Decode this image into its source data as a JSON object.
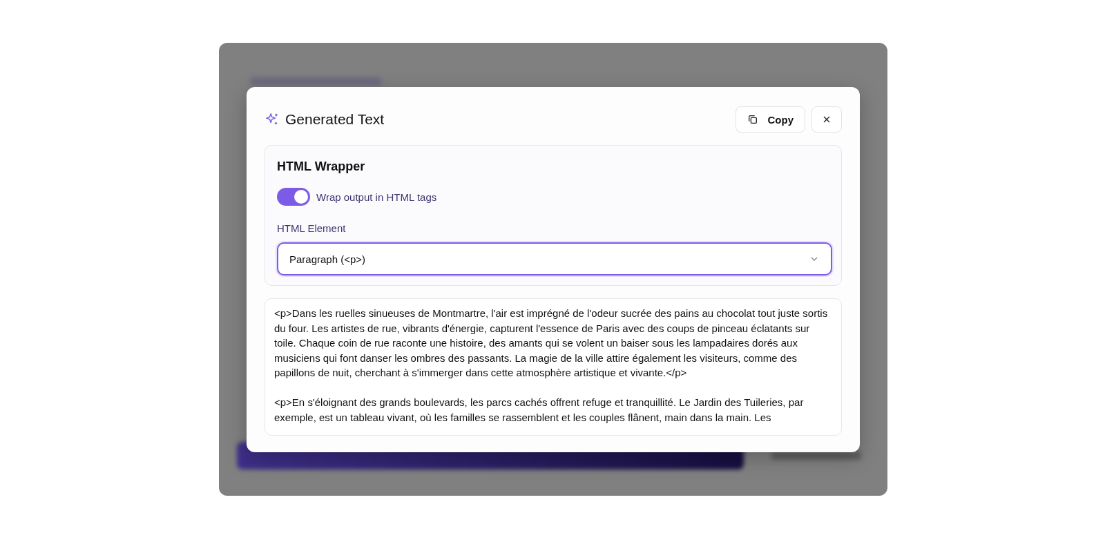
{
  "dialog": {
    "title": "Generated Text",
    "copy_button": "Copy"
  },
  "wrapper": {
    "heading": "HTML Wrapper",
    "toggle": {
      "label": "Wrap output in HTML tags",
      "on": true
    },
    "element_label": "HTML Element",
    "select": {
      "value": "Paragraph (<p>)",
      "focused": true
    }
  },
  "output": {
    "text": "<p>Dans les ruelles sinueuses de Montmartre, l'air est imprégné de l'odeur sucrée des pains au chocolat tout juste sortis du four. Les artistes de rue, vibrants d'énergie, capturent l'essence de Paris avec des coups de pinceau éclatants sur toile. Chaque coin de rue raconte une histoire, des amants qui se volent un baiser sous les lampadaires dorés aux musiciens qui font danser les ombres des passants. La magie de la ville attire également les visiteurs, comme des papillons de nuit, cherchant à s'immerger dans cette atmosphère artistique et vivante.</p>\n\n<p>En s'éloignant des grands boulevards, les parcs cachés offrent refuge et tranquillité. Le Jardin des Tuileries, par exemple, est un tableau vivant, où les familles se rassemblent et les couples flânent, main dans la main. Les"
  }
}
